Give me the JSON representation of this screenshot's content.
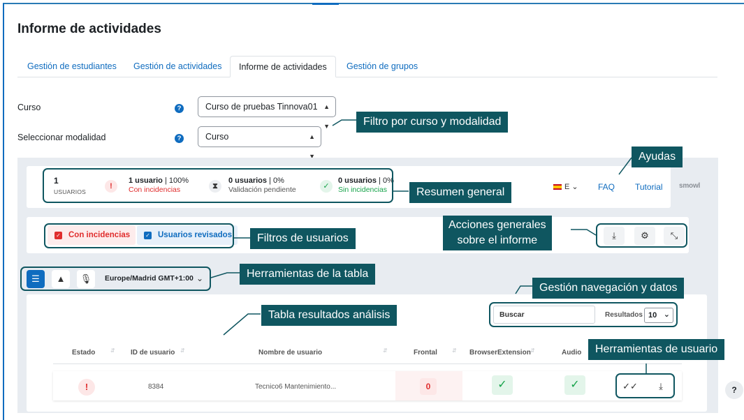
{
  "page": {
    "title": "Informe de actividades"
  },
  "tabs": [
    {
      "label": "Gestión de estudiantes"
    },
    {
      "label": "Gestión de actividades"
    },
    {
      "label": "Informe de actividades"
    },
    {
      "label": "Gestión de grupos"
    }
  ],
  "form": {
    "course_label": "Curso",
    "course_value": "Curso de pruebas Tinnova01",
    "mode_label": "Seleccionar modalidad",
    "mode_value": "Curso",
    "help_glyph": "?"
  },
  "summary": {
    "count": "1",
    "count_label": "USUARIOS",
    "stats": [
      {
        "icon": "!",
        "main_bold": "1 usuario",
        "main_rest": " | 100%",
        "sub": "Con incidencias",
        "color": "#e02d2d"
      },
      {
        "icon": "⧗",
        "main_bold": "0 usuarios",
        "main_rest": " | 0%",
        "sub": "Validación pendiente",
        "color": "#555555"
      },
      {
        "icon": "✓",
        "main_bold": "0 usuarios",
        "main_rest": " | 0%",
        "sub": "Sin incidencias",
        "color": "#16a34a"
      }
    ],
    "lang": "E",
    "faq": "FAQ",
    "tutorial": "Tutorial",
    "logo": "smowl"
  },
  "filters": {
    "incidents": "Con incidencias",
    "reviewed": "Usuarios revisados"
  },
  "table_tools": {
    "timezone": "Europe/Madrid GMT+1:00"
  },
  "nav": {
    "search_placeholder": "Buscar",
    "results_label": "Resultados",
    "results_value": "10"
  },
  "table": {
    "headers": [
      "Estado",
      "ID de usuario",
      "Nombre de usuario",
      "Frontal",
      "BrowserExtension",
      "Audio"
    ],
    "rows": [
      {
        "estado": "!",
        "id": "8384",
        "nombre": "Tecnico6 Mantenimiento...",
        "frontal": "0",
        "browser": "✓",
        "audio": "✓"
      }
    ]
  },
  "callouts": {
    "filtro_curso": "Filtro por curso y modalidad",
    "ayudas": "Ayudas",
    "resumen": "Resumen general",
    "filtros_usuarios": "Filtros de usuarios",
    "acciones_l1": "Acciones generales",
    "acciones_l2": "sobre el informe",
    "herramientas_tabla": "Herramientas de la tabla",
    "gestion_nav": "Gestión navegación y datos",
    "tabla_resultados": "Tabla resultados análisis",
    "herramientas_usuario": "Herramientas de usuario"
  },
  "colors": {
    "accent": "#0f6cbf",
    "callout": "#0f5660",
    "danger": "#e02d2d",
    "success": "#16a34a"
  },
  "floating_help": "?"
}
